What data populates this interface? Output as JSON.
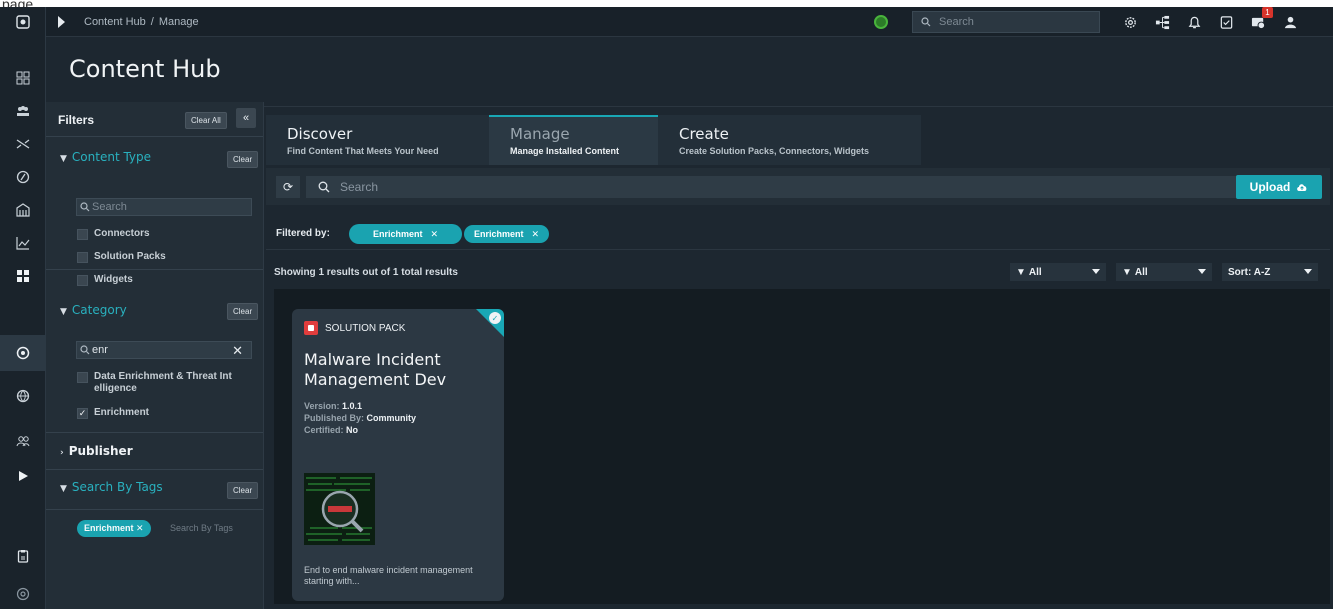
{
  "browser": {
    "page_caption": "page"
  },
  "topbar": {
    "breadcrumb": [
      "Content Hub",
      "Manage"
    ],
    "search_placeholder": "Search",
    "notification_count": "1"
  },
  "page": {
    "title": "Content Hub"
  },
  "filters": {
    "title": "Filters",
    "clear_all": "Clear All",
    "collapse_glyph": "«",
    "content_type": {
      "title": "Content Type",
      "clear": "Clear",
      "search_placeholder": "Search",
      "options": [
        "Connectors",
        "Solution Packs",
        "Widgets"
      ]
    },
    "category": {
      "title": "Category",
      "clear": "Clear",
      "search_value": "enr",
      "options": [
        {
          "label": "Data Enrichment & Threat Int elligence",
          "checked": false
        },
        {
          "label": "Enrichment",
          "checked": true
        }
      ]
    },
    "publisher": {
      "title": "Publisher"
    },
    "tags": {
      "title": "Search By Tags",
      "clear": "Clear",
      "chip": "Enrichment",
      "placeholder": "Search By Tags"
    }
  },
  "tabs": [
    {
      "title": "Discover",
      "subtitle": "Find Content That Meets Your Need"
    },
    {
      "title": "Manage",
      "subtitle": "Manage Installed Content"
    },
    {
      "title": "Create",
      "subtitle": "Create Solution Packs, Connectors, Widgets"
    }
  ],
  "main": {
    "search_placeholder": "Search",
    "upload_label": "Upload",
    "filtered_by_label": "Filtered by:",
    "filter_chips": [
      "Enrichment",
      "Enrichment"
    ],
    "results_text": "Showing 1 results out of 1 total results",
    "dropdowns": [
      "All",
      "All",
      "Sort: A-Z"
    ]
  },
  "card": {
    "type": "SOLUTION PACK",
    "title": "Malware Incident Management Dev",
    "version_label": "Version:",
    "version": "1.0.1",
    "published_label": "Published By:",
    "published_by": "Community",
    "certified_label": "Certified:",
    "certified": "No",
    "description": "End to end malware incident management starting with..."
  },
  "colors": {
    "accent": "#1aa3b0",
    "background": "#1d2730",
    "panel": "#232e37",
    "badge": "#d7342b"
  },
  "icons": [
    "home-icon",
    "dashboard-icon",
    "teams-icon",
    "shuffle-icon",
    "speed-icon",
    "building-icon",
    "chart-icon",
    "apps-icon",
    "content-hub-icon",
    "globe-icon",
    "people-icon",
    "play-icon",
    "clipboard-icon",
    "at-icon"
  ]
}
